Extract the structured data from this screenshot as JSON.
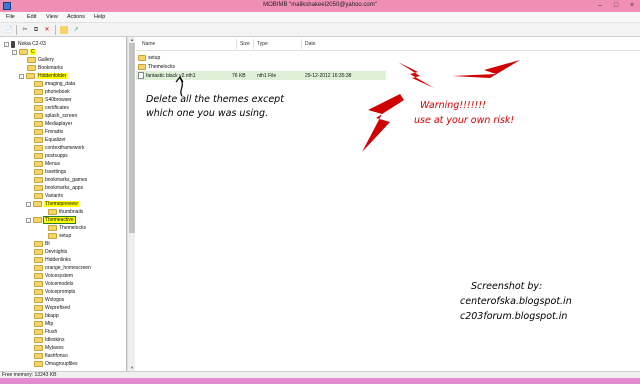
{
  "window": {
    "title": "MOBIMB \"malikshakeel2050@yahoo.com\""
  },
  "menu": [
    "File",
    "Edit",
    "View",
    "Actions",
    "Help"
  ],
  "toolbar_icons": [
    "new-icon",
    "cut-icon",
    "copy-icon",
    "delete-icon",
    "folder-up-icon",
    "export-icon"
  ],
  "tree": {
    "root": "Nokia C2-03",
    "drive": "C",
    "items": [
      "Gallery",
      "Bookmarks"
    ],
    "hidden_folder": "Hiddenfolder",
    "hidden_children": [
      "imaging_data",
      "phonebook",
      "S40browser",
      "certificates",
      "splash_screen",
      "Mediaplayer",
      "Fmradio",
      "Equalizer",
      "contextframework",
      "postsupps",
      "Menus",
      "Issettings",
      "bookmarks_games",
      "bookmarks_apps",
      "Variants"
    ],
    "themepreview": "Themepreview",
    "themepreview_children": [
      "thumbnails"
    ],
    "themeactive": "Themeactive",
    "themeactive_children": [
      "Themelocks",
      "setup"
    ],
    "more_items": [
      "Bt",
      "Devnights",
      "Hiddenlinks",
      "orange_homescreen",
      "Voicesystem",
      "Voicemodels",
      "Voiceprompts",
      "Wvlogos",
      "Wvprefixed",
      "bkapp",
      "Mtp",
      "Flush",
      "Idleskins",
      "Mytaxes",
      "flashfonso",
      "Omagroupfiles"
    ]
  },
  "columns": {
    "name": "Name",
    "size": "Size",
    "type": "Type",
    "date": "Date"
  },
  "files": [
    {
      "name": "setup",
      "kind": "folder",
      "size": "",
      "type": "",
      "date": ""
    },
    {
      "name": "Themelocks",
      "kind": "folder",
      "size": "",
      "type": "",
      "date": ""
    },
    {
      "name": "fantastic black v2.nth1",
      "kind": "file",
      "size": "76 KB",
      "type": "nth1 File",
      "date": "29-12-2012 16:35:38"
    }
  ],
  "annotations": {
    "instruction": [
      "Delete all the themes except",
      "which one you was using."
    ],
    "warning": [
      "Warning!!!!!!!",
      "use at your own risk!"
    ],
    "credit": [
      "Screenshot by:",
      "centerofska.blogspot.in",
      "c203forum.blogspot.in"
    ]
  },
  "status": {
    "memory": "Free memory: 13243 KB"
  },
  "colors": {
    "titlebar": "#f08fb4",
    "highlight": "#ffff00",
    "annotation_red": "#d00000",
    "taskbar": "#e28bd0"
  }
}
